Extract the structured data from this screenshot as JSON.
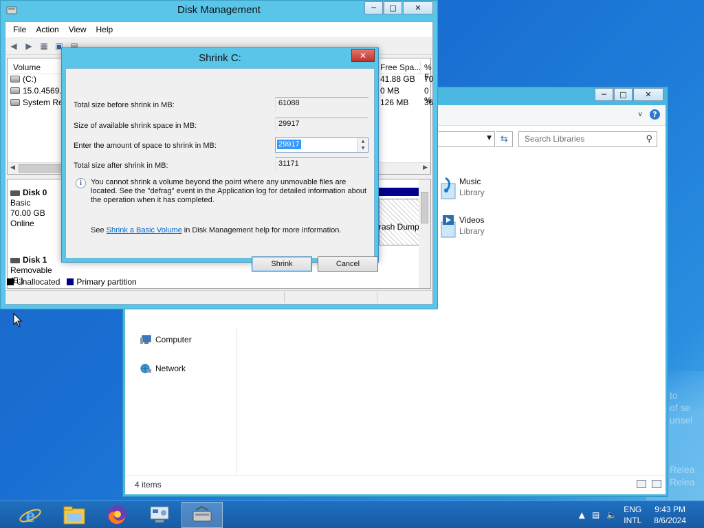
{
  "disk_management": {
    "title": "Disk Management",
    "menu": [
      "File",
      "Action",
      "View",
      "Help"
    ],
    "columns": {
      "volume": "Volume",
      "free_space": "Free Spa...",
      "percent_free": "% F"
    },
    "volumes": [
      {
        "name": "(C:)",
        "free": "41.88 GB",
        "pct": "70"
      },
      {
        "name": "15.0.4569.1",
        "free": "0 MB",
        "pct": "0 %"
      },
      {
        "name": "System Res",
        "free": "126 MB",
        "pct": "36"
      }
    ],
    "disks": [
      {
        "name": "Disk 0",
        "type": "Basic",
        "size": "70.00 GB",
        "status": "Online"
      },
      {
        "name": "Disk 1",
        "type": "Removable (E:)"
      }
    ],
    "partition_text": "rash Dump",
    "legend": [
      {
        "label": "Unallocated",
        "color": "#000000"
      },
      {
        "label": "Primary partition",
        "color": "#00008b"
      }
    ]
  },
  "shrink_dialog": {
    "title": "Shrink C:",
    "fields": [
      {
        "label": "Total size before shrink in MB:",
        "value": "61088"
      },
      {
        "label": "Size of available shrink space in MB:",
        "value": "29917"
      },
      {
        "label": "Enter the amount of space to shrink in MB:",
        "value": "29917"
      },
      {
        "label": "Total size after shrink in MB:",
        "value": "31171"
      }
    ],
    "info": "You cannot shrink a volume beyond the point where any unmovable files are located. See the \"defrag\" event in the Application log for detailed information about the operation when it has completed.",
    "see_prefix": "See",
    "see_link": "Shrink a Basic Volume",
    "see_suffix": "in Disk Management help for more information.",
    "shrink_button": "Shrink",
    "cancel_button": "Cancel"
  },
  "explorer": {
    "search_placeholder": "Search Libraries",
    "libraries": [
      {
        "name": "Music",
        "type": "Library"
      },
      {
        "name": "Videos",
        "type": "Library"
      }
    ],
    "nav": [
      {
        "name": "Computer"
      },
      {
        "name": "Network"
      }
    ],
    "status": "4 items"
  },
  "taskbar": {
    "apps": [
      "internet-explorer",
      "file-explorer",
      "firefox",
      "control-panel",
      "disk-management"
    ],
    "active_app": "disk-management",
    "language": {
      "line1": "ENG",
      "line2": "INTL"
    },
    "time": "9:43 PM",
    "date": "8/6/2024"
  },
  "colors": {
    "accent_titlebar": "#59c5e8",
    "desktop": "#1a5ebe",
    "selection": "#3399ff",
    "link": "#0066cc"
  }
}
